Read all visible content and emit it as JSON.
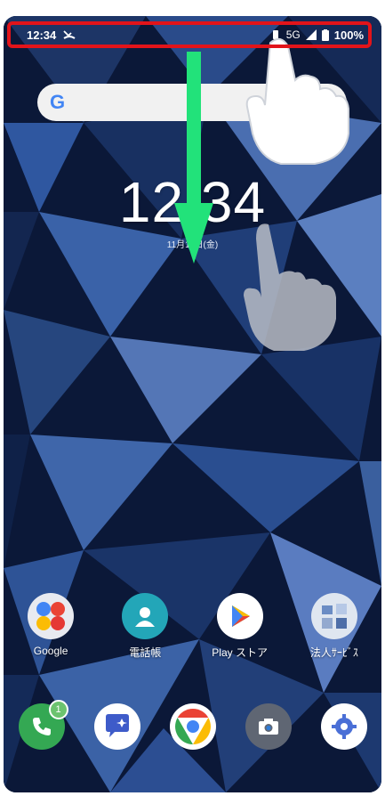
{
  "status_bar": {
    "time": "12:34",
    "network": "5G",
    "battery": "100%"
  },
  "clock": {
    "time": "12:34",
    "date": "11月11日(金)"
  },
  "apps_top": [
    {
      "label": "Google",
      "icon": "google-folder-icon"
    },
    {
      "label": "電話帳",
      "icon": "contacts-icon"
    },
    {
      "label": "Play ストア",
      "icon": "play-store-icon"
    },
    {
      "label": "法人ｻｰﾋﾞｽ",
      "icon": "business-service-icon"
    }
  ],
  "dock": [
    {
      "icon": "phone-icon",
      "badge": "1"
    },
    {
      "icon": "softbank-message-icon"
    },
    {
      "icon": "chrome-icon"
    },
    {
      "icon": "camera-icon"
    },
    {
      "icon": "settings-icon"
    }
  ],
  "colors": {
    "highlight": "#e2141a",
    "arrow": "#22e27a",
    "wallpaper_dark": "#0b1838",
    "wallpaper_light": "#5a7bb8"
  }
}
